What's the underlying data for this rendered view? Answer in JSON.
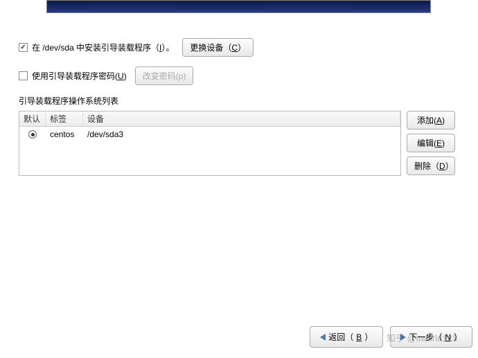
{
  "install_bootloader": {
    "checked": true,
    "label_prefix": "在 /dev/sda 中安装引导装载程序（",
    "mnemonic": "I",
    "label_suffix": "）。"
  },
  "change_device_btn": {
    "prefix": "更换设备（",
    "mnemonic": "C",
    "suffix": "）"
  },
  "use_password": {
    "checked": false,
    "label_prefix": "使用引导装载程序密码(",
    "mnemonic": "U",
    "label_suffix": ")"
  },
  "change_password_btn": {
    "prefix": "改变密码(",
    "mnemonic": "p",
    "suffix": ")"
  },
  "section_title": "引导装载程序操作系统列表",
  "table": {
    "headers": {
      "default": "默认",
      "label": "标签",
      "device": "设备"
    },
    "rows": [
      {
        "selected": true,
        "label": "centos",
        "device": "/dev/sda3"
      }
    ]
  },
  "side": {
    "add": {
      "prefix": "添加(",
      "mnemonic": "A",
      "suffix": ")"
    },
    "edit": {
      "prefix": "编辑(",
      "mnemonic": "E",
      "suffix": ")"
    },
    "delete": {
      "prefix": "删除（",
      "mnemonic": "D",
      "suffix": "）"
    }
  },
  "footer": {
    "back": {
      "prefix": "返回（",
      "mnemonic": "B",
      "suffix": "）"
    },
    "next": {
      "prefix": "下一步（",
      "mnemonic": "N",
      "suffix": "）"
    }
  },
  "watermark": "知乎 @itworld123"
}
